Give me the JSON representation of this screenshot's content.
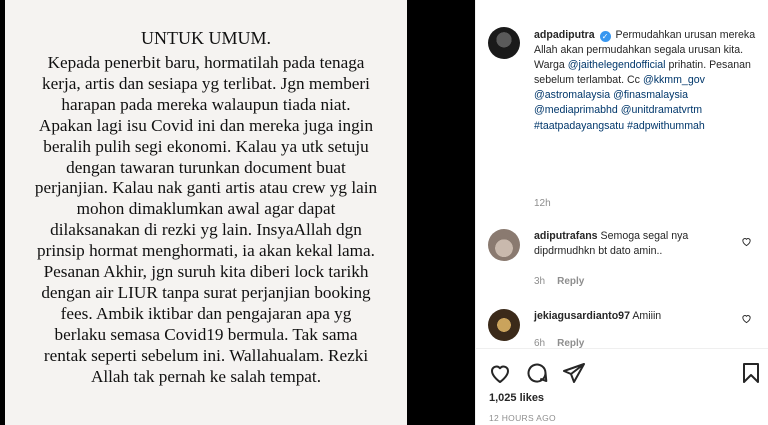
{
  "post_image": {
    "title": "UNTUK UMUM.",
    "lines": [
      "Kepada penerbit baru, hormatilah pada tenaga",
      "kerja, artis dan sesiapa yg terlibat. Jgn memberi",
      "harapan pada mereka walaupun tiada niat.",
      "Apakan lagi isu Covid ini dan mereka juga ingin",
      "beralih pulih segi ekonomi. Kalau ya utk setuju",
      "dengan tawaran turunkan document buat",
      "perjanjian. Kalau nak ganti artis atau crew yg lain",
      "mohon dimaklumkan awal agar dapat",
      "dilaksanakan di rezki yg lain. InsyaAllah dgn",
      "prinsip hormat menghormati, ia akan kekal lama.",
      "Pesanan Akhir, jgn suruh kita diberi lock tarikh",
      "dengan air LIUR  tanpa surat perjanjian booking",
      "fees. Ambik iktibar dan pengajaran apa yg",
      "berlaku semasa Covid19 bermula. Tak sama",
      "rentak seperti sebelum ini. Wallahualam. Rezki",
      "Allah tak pernah ke salah tempat."
    ]
  },
  "caption": {
    "username": "adpadiputra",
    "verified_mark": "✓",
    "text_1": "Permudahkan urusan mereka Allah akan permudahkan segala urusan kita. Warga",
    "mention_1": "@jaithelegendofficial",
    "text_2": "prihatin. Pesanan sebelum terlambat. Cc",
    "mention_2": "@kkmm_gov",
    "mention_3": "@astromalaysia",
    "mention_4": "@finasmalaysia",
    "mention_5": "@mediaprimabhd",
    "mention_6": "@unitdramatvrtm",
    "hashtag_1": "#taatpadayangsatu",
    "hashtag_2": "#adpwithummah",
    "timestamp": "12h"
  },
  "comments": [
    {
      "username": "adiputrafans",
      "text": "Semoga segal nya dipdrmudhkn bt dato amin..",
      "age": "3h",
      "reply_label": "Reply"
    },
    {
      "username": "jekiagusardianto97",
      "text": "Amiiin",
      "age": "6h",
      "reply_label": "Reply"
    }
  ],
  "actions": {
    "likes": "1,025 likes",
    "posted_ago": "12 HOURS AGO"
  },
  "icons": {
    "like": "heart-icon",
    "comment": "comment-icon",
    "share": "share-icon",
    "save": "bookmark-icon",
    "comment_like": "small-heart-icon"
  },
  "colors": {
    "link": "#00376b",
    "verified": "#3897f0",
    "muted": "#8e8e8e"
  }
}
